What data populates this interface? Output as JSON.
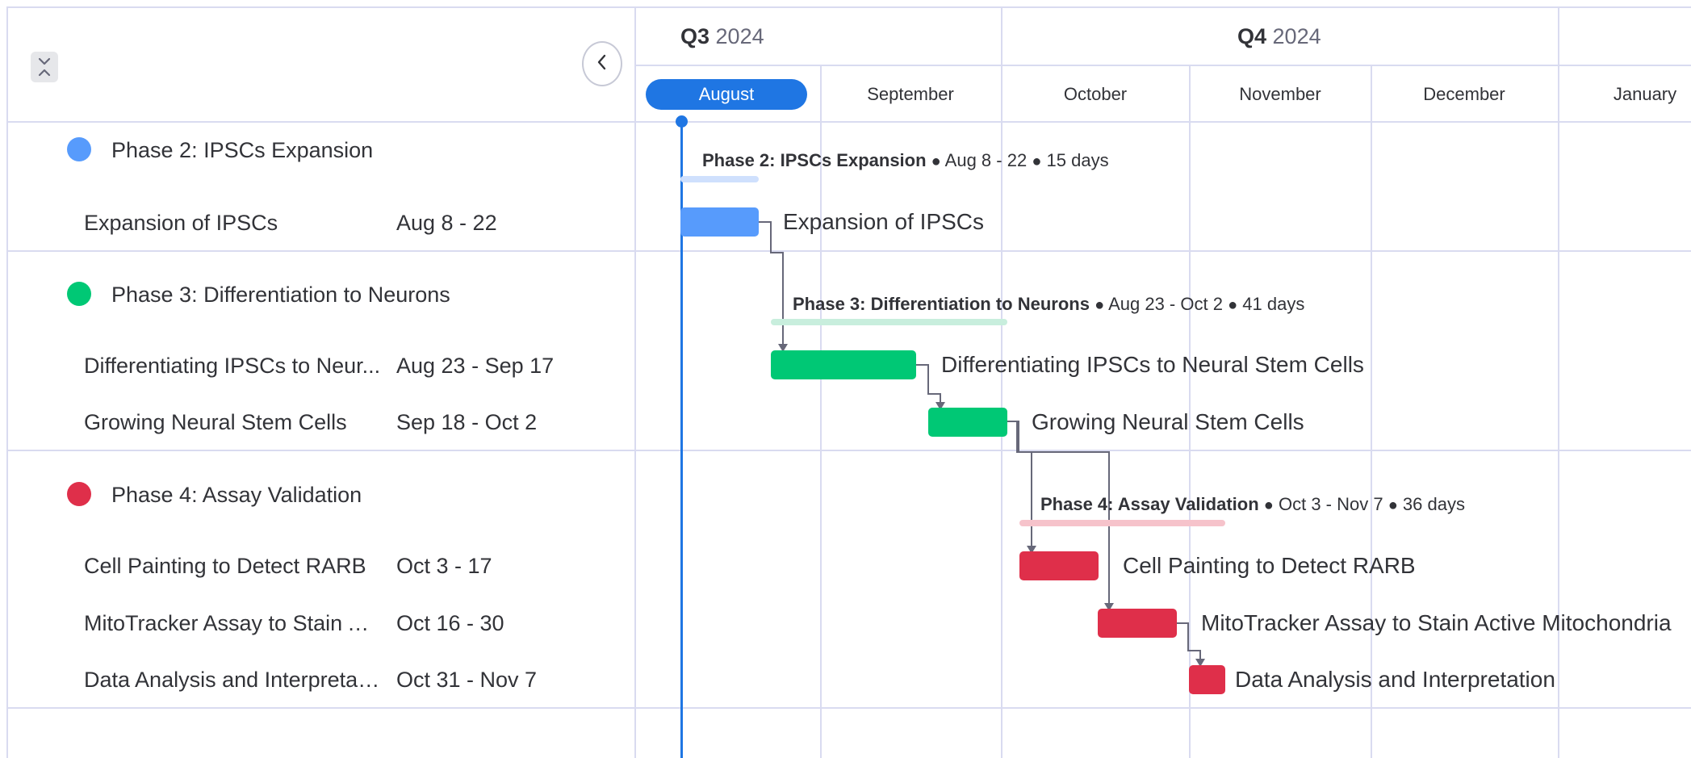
{
  "colors": {
    "blue": "#579bfc",
    "green": "#00c875",
    "red": "#df2f4a",
    "accent": "#1f76e3",
    "grid": "#d9dbf0"
  },
  "icons": {
    "collapse_all": "collapse-expand-icon",
    "panel_toggle": "chevron-left-icon"
  },
  "timeline": {
    "quarters": [
      {
        "label_bold": "Q3",
        "label_rest": " 2024"
      },
      {
        "label_bold": "Q4",
        "label_rest": " 2024"
      }
    ],
    "months": [
      "August",
      "September",
      "October",
      "November",
      "December",
      "January"
    ],
    "selected_month": "August"
  },
  "groups": [
    {
      "title": "Phase 2: IPSCs Expansion",
      "summary_dates": "Aug 8 - 22",
      "summary_duration": "15 days",
      "items": [
        {
          "name": "Expansion of IPSCs",
          "dates": "Aug 8 - 22",
          "full_name": "Expansion of IPSCs"
        }
      ]
    },
    {
      "title": "Phase 3: Differentiation to Neurons",
      "summary_dates": "Aug 23 - Oct 2",
      "summary_duration": "41 days",
      "items": [
        {
          "name": "Differentiating IPSCs to Neur...",
          "dates": "Aug 23 - Sep 17",
          "full_name": "Differentiating IPSCs to Neural Stem Cells"
        },
        {
          "name": "Growing Neural Stem Cells",
          "dates": "Sep 18 - Oct 2",
          "full_name": "Growing Neural Stem Cells"
        }
      ]
    },
    {
      "title": "Phase 4: Assay Validation",
      "summary_dates": "Oct 3 - Nov 7",
      "summary_duration": "36 days",
      "items": [
        {
          "name": "Cell Painting to Detect RARB",
          "dates": "Oct 3 - 17",
          "full_name": "Cell Painting to Detect RARB"
        },
        {
          "name": "MitoTracker Assay to Stain Ac...",
          "dates": "Oct 16 - 30",
          "full_name": "MitoTracker Assay to Stain Active Mitochondria"
        },
        {
          "name": "Data Analysis and Interpretati...",
          "dates": "Oct 31 - Nov 7",
          "full_name": "Data Analysis and Interpretation"
        }
      ]
    }
  ],
  "separator": "●"
}
